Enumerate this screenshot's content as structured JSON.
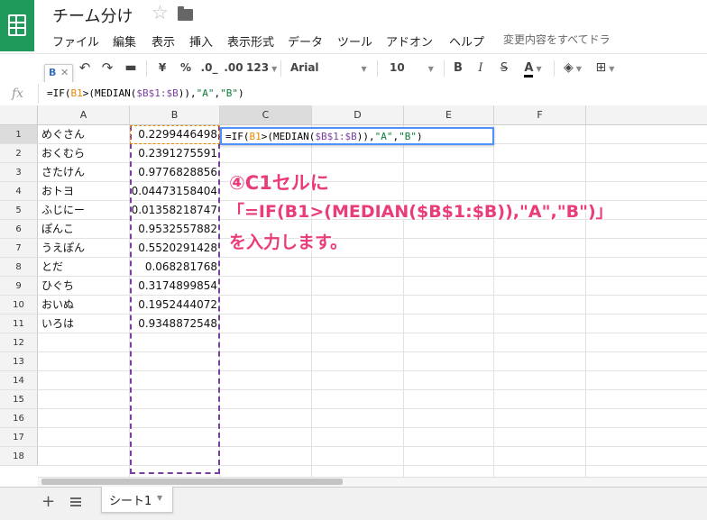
{
  "app": {
    "title": "チーム分け",
    "menu": [
      "ファイル",
      "編集",
      "表示",
      "挿入",
      "表示形式",
      "データ",
      "ツール",
      "アドオン",
      "ヘルプ"
    ],
    "save_status": "変更内容をすべてドラ"
  },
  "toolbar": {
    "currency": "¥",
    "percent": "%",
    "dec_decrease": ".0_",
    "dec_increase": ".00",
    "number_format": "123",
    "font": "Arial",
    "font_size": "10",
    "bold": "B",
    "italic": "I",
    "strike": "S",
    "text_color": "A"
  },
  "name_box": {
    "cell": "B"
  },
  "formula_bar": {
    "fx": "fx",
    "formula_parts": [
      "=IF(",
      "B1",
      ">(MEDIAN(",
      "$B$1:$B",
      ")),",
      "\"A\"",
      ",",
      "\"B\"",
      ")"
    ]
  },
  "grid": {
    "columns": [
      "A",
      "B",
      "C",
      "D",
      "E",
      "F"
    ],
    "rows": [
      "1",
      "2",
      "3",
      "4",
      "5",
      "6",
      "7",
      "8",
      "9",
      "10",
      "11",
      "12",
      "13",
      "14",
      "15",
      "16",
      "17",
      "18"
    ],
    "col_a": [
      "めぐさん",
      "おくむら",
      "さたけん",
      "おトヨ",
      "ふじにー",
      "ぽんこ",
      "うえぽん",
      "とだ",
      "ひぐち",
      "おいぬ",
      "いろは"
    ],
    "col_b": [
      "0.2299446498",
      "0.2391275591",
      "0.9776828856",
      "0.04473158404",
      "0.01358218747",
      "0.9532557882",
      "0.5520291428",
      "0.068281768",
      "0.3174899854",
      "0.1952444072",
      "0.9348872548"
    ]
  },
  "annotation": {
    "line1": "④C1セルに",
    "line2": "「=IF(B1>(MEDIAN($B$1:$B)),\"A\",\"B\")」",
    "line3": "を入力します。"
  },
  "sheets": {
    "add": "+",
    "active": "シート1"
  }
}
